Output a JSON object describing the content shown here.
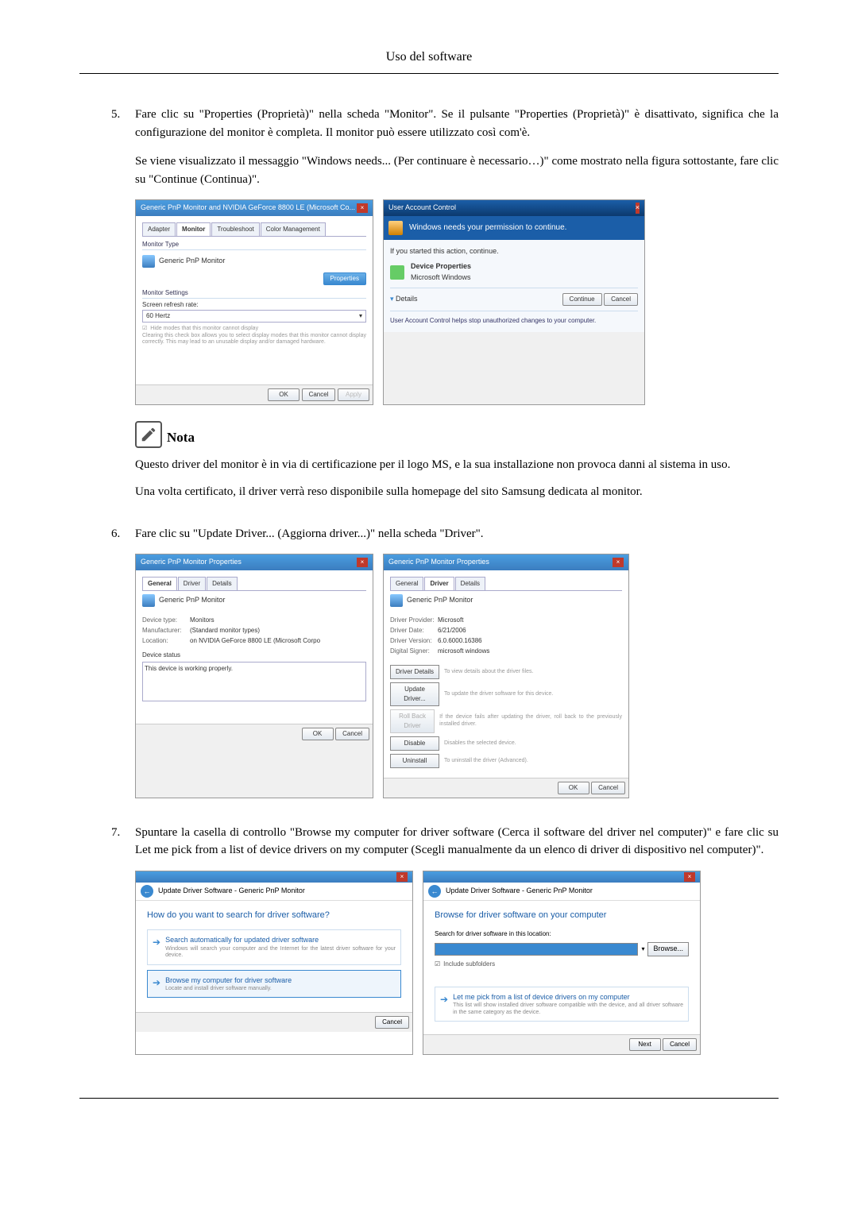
{
  "page_title": "Uso del software",
  "step5": {
    "num": "5.",
    "p1": "Fare clic su \"Properties (Proprietà)\" nella scheda \"Monitor\". Se il pulsante \"Properties (Proprietà)\" è disattivato, significa che la configurazione del monitor è completa. Il monitor può essere utilizzato così com'è.",
    "p2": "Se viene visualizzato il messaggio \"Windows needs... (Per continuare è necessario…)\" come mostrato nella figura sottostante, fare clic su \"Continue (Continua)\".",
    "dlg1": {
      "title": "Generic PnP Monitor and NVIDIA GeForce 8800 LE (Microsoft Co...",
      "tabs": [
        "Adapter",
        "Monitor",
        "Troubleshoot",
        "Color Management"
      ],
      "monitor_type": "Monitor Type",
      "monitor_name": "Generic PnP Monitor",
      "properties_btn": "Properties",
      "settings_hdr": "Monitor Settings",
      "refresh_lbl": "Screen refresh rate:",
      "refresh_val": "60 Hertz",
      "hide_chk": "Hide modes that this monitor cannot display",
      "hide_txt": "Clearing this check box allows you to select display modes that this monitor cannot display correctly. This may lead to an unusable display and/or damaged hardware.",
      "ok": "OK",
      "cancel": "Cancel",
      "apply": "Apply"
    },
    "uac": {
      "title": "User Account Control",
      "header": "Windows needs your permission to continue.",
      "started": "If you started this action, continue.",
      "prog_name": "Device Properties",
      "prog_pub": "Microsoft Windows",
      "details_btn": "Details",
      "continue_btn": "Continue",
      "cancel_btn": "Cancel",
      "footer": "User Account Control helps stop unauthorized changes to your computer."
    }
  },
  "note": {
    "label": "Nota",
    "p1": "Questo driver del monitor è in via di certificazione per il logo MS, e la sua installazione non provoca danni al sistema in uso.",
    "p2": "Una volta certificato, il driver verrà reso disponibile sulla homepage del sito Samsung dedicata al monitor."
  },
  "step6": {
    "num": "6.",
    "text": "Fare clic su \"Update Driver... (Aggiorna driver...)\" nella scheda \"Driver\".",
    "dlg_gen": {
      "title": "Generic PnP Monitor Properties",
      "tabs": [
        "General",
        "Driver",
        "Details"
      ],
      "name": "Generic PnP Monitor",
      "type_k": "Device type:",
      "type_v": "Monitors",
      "mfg_k": "Manufacturer:",
      "mfg_v": "(Standard monitor types)",
      "loc_k": "Location:",
      "loc_v": "on NVIDIA GeForce 8800 LE (Microsoft Corpo",
      "status_hdr": "Device status",
      "status_txt": "This device is working properly.",
      "ok": "OK",
      "cancel": "Cancel"
    },
    "dlg_drv": {
      "title": "Generic PnP Monitor Properties",
      "tabs": [
        "General",
        "Driver",
        "Details"
      ],
      "name": "Generic PnP Monitor",
      "prov_k": "Driver Provider:",
      "prov_v": "Microsoft",
      "date_k": "Driver Date:",
      "date_v": "6/21/2006",
      "ver_k": "Driver Version:",
      "ver_v": "6.0.6000.16386",
      "sign_k": "Digital Signer:",
      "sign_v": "microsoft windows",
      "details_btn": "Driver Details",
      "details_txt": "To view details about the driver files.",
      "update_btn": "Update Driver...",
      "update_txt": "To update the driver software for this device.",
      "roll_btn": "Roll Back Driver",
      "roll_txt": "If the device fails after updating the driver, roll back to the previously installed driver.",
      "disable_btn": "Disable",
      "disable_txt": "Disables the selected device.",
      "uninst_btn": "Uninstall",
      "uninst_txt": "To uninstall the driver (Advanced).",
      "ok": "OK",
      "cancel": "Cancel"
    }
  },
  "step7": {
    "num": "7.",
    "text": "Spuntare la casella di controllo \"Browse my computer for driver software (Cerca il software del driver nel computer)\" e fare clic su Let me pick from a list of device drivers on my computer (Scegli manualmente da un elenco di driver di dispositivo nel computer)\".",
    "wiz1": {
      "crumb": "Update Driver Software - Generic PnP Monitor",
      "q": "How do you want to search for driver software?",
      "opt1_t": "Search automatically for updated driver software",
      "opt1_s": "Windows will search your computer and the Internet for the latest driver software for your device.",
      "opt2_t": "Browse my computer for driver software",
      "opt2_s": "Locate and install driver software manually.",
      "cancel": "Cancel"
    },
    "wiz2": {
      "crumb": "Update Driver Software - Generic PnP Monitor",
      "q": "Browse for driver software on your computer",
      "search_lbl": "Search for driver software in this location:",
      "browse": "Browse...",
      "include": "Include subfolders",
      "pick_t": "Let me pick from a list of device drivers on my computer",
      "pick_s": "This list will show installed driver software compatible with the device, and all driver software in the same category as the device.",
      "next": "Next",
      "cancel": "Cancel"
    }
  }
}
